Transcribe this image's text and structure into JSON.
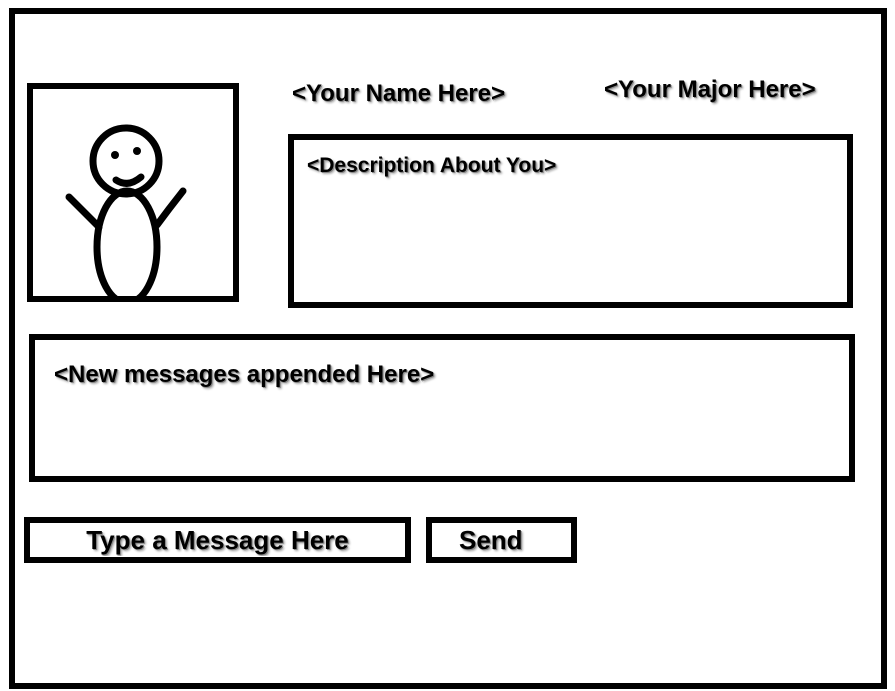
{
  "profile": {
    "name_placeholder": "<Your Name Here>",
    "major_placeholder": "<Your Major Here>",
    "description_placeholder": "<Description About You>",
    "avatar_icon": "stick-figure-icon"
  },
  "chat": {
    "messages_placeholder": "<New messages appended Here>",
    "input_placeholder": "Type a Message Here",
    "send_label": "Send"
  },
  "colors": {
    "border": "#000000",
    "background": "#ffffff"
  }
}
